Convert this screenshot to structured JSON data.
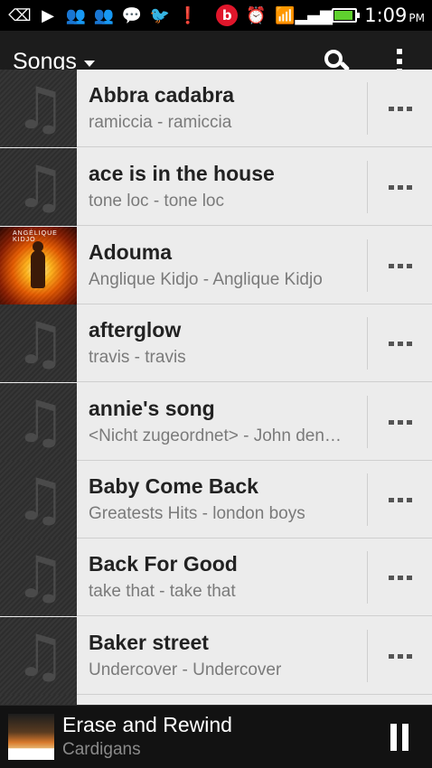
{
  "status_bar": {
    "icons": [
      "back-icon",
      "play-icon",
      "people-icon",
      "people-icon",
      "chat-icon",
      "twitter-icon",
      "alert-icon"
    ],
    "beats_glyph": "b",
    "time": "1:09",
    "ampm": "PM"
  },
  "header": {
    "title": "Songs"
  },
  "songs": [
    {
      "title": "Abbra cadabra",
      "subtitle": "ramiccia - ramiccia",
      "has_art": false
    },
    {
      "title": "ace is in the house",
      "subtitle": "tone loc - tone loc",
      "has_art": false
    },
    {
      "title": "Adouma",
      "subtitle": "Anglique Kidjo - Anglique Kidjo",
      "has_art": true,
      "art_text": "ANGÉLIQUE KIDJO"
    },
    {
      "title": "afterglow",
      "subtitle": "travis - travis",
      "has_art": false
    },
    {
      "title": "annie's song",
      "subtitle": "<Nicht zugeordnet> - John den…",
      "has_art": false
    },
    {
      "title": "Baby Come Back",
      "subtitle": "Greatests Hits - london boys",
      "has_art": false
    },
    {
      "title": "Back For Good",
      "subtitle": "take that - take that",
      "has_art": false
    },
    {
      "title": "Baker street",
      "subtitle": "Undercover - Undercover",
      "has_art": false
    }
  ],
  "now_playing": {
    "title": "Erase and Rewind",
    "artist": "Cardigans"
  },
  "colors": {
    "background": "#ececec",
    "app_bar": "#1c1c1c",
    "battery": "#5fd02e",
    "beats": "#e0162b"
  }
}
